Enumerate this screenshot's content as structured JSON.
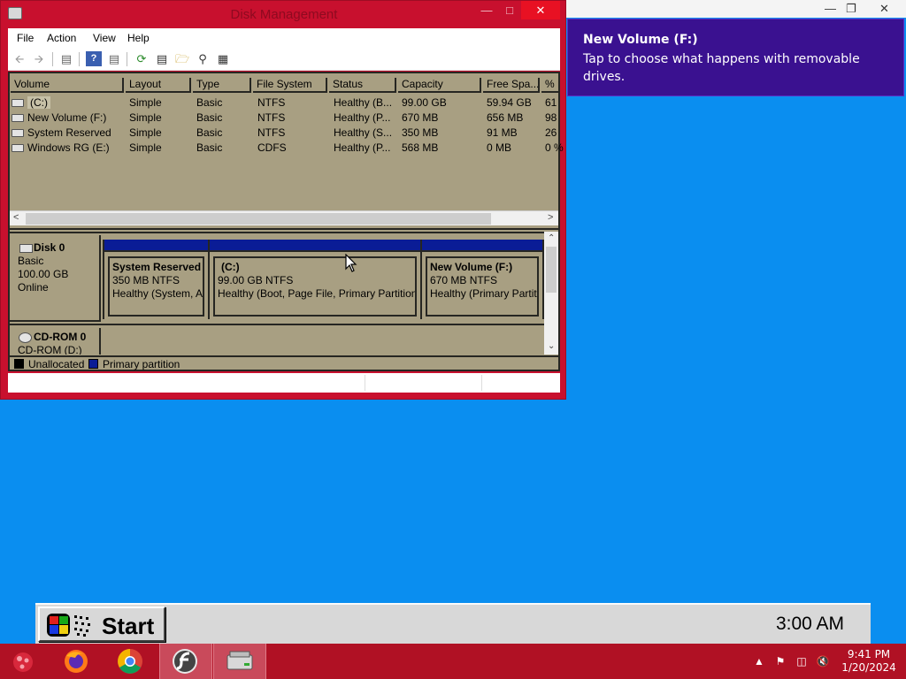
{
  "dm_window": {
    "title": "Disk Management",
    "menu": [
      "File",
      "Action",
      "View",
      "Help"
    ],
    "columns": [
      "Volume",
      "Layout",
      "Type",
      "File System",
      "Status",
      "Capacity",
      "Free Spa...",
      "% F"
    ],
    "volumes": [
      {
        "volume": "(C:)",
        "layout": "Simple",
        "type": "Basic",
        "fs": "NTFS",
        "status": "Healthy (B...",
        "capacity": "99.00 GB",
        "free": "59.94 GB",
        "pct": "61"
      },
      {
        "volume": "New Volume (F:)",
        "layout": "Simple",
        "type": "Basic",
        "fs": "NTFS",
        "status": "Healthy (P...",
        "capacity": "670 MB",
        "free": "656 MB",
        "pct": "98"
      },
      {
        "volume": "System Reserved",
        "layout": "Simple",
        "type": "Basic",
        "fs": "NTFS",
        "status": "Healthy (S...",
        "capacity": "350 MB",
        "free": "91 MB",
        "pct": "26"
      },
      {
        "volume": "Windows RG (E:)",
        "layout": "Simple",
        "type": "Basic",
        "fs": "CDFS",
        "status": "Healthy (P...",
        "capacity": "568 MB",
        "free": "0 MB",
        "pct": "0 %"
      }
    ],
    "disk0": {
      "name": "Disk 0",
      "type": "Basic",
      "size": "100.00 GB",
      "state": "Online"
    },
    "partitions": [
      {
        "name": "System Reserved",
        "size": "350 MB NTFS",
        "status": "Healthy (System, Ac"
      },
      {
        "name": "(C:)",
        "size": "99.00 GB NTFS",
        "status": "Healthy (Boot, Page File, Primary Partition)"
      },
      {
        "name": "New Volume  (F:)",
        "size": "670 MB NTFS",
        "status": "Healthy (Primary Partit"
      }
    ],
    "cdrom": {
      "name": "CD-ROM 0",
      "sub": "CD-ROM (D:)"
    },
    "legend": {
      "unallocated": "Unallocated",
      "primary": "Primary partition",
      "unallocated_color": "#000000",
      "primary_color": "#0a1c96"
    }
  },
  "notification": {
    "title": "New Volume (F:)",
    "body": "Tap to choose what happens with removable drives."
  },
  "retro_bar": {
    "start_label": "Start",
    "clock": "3:00 AM"
  },
  "taskbar": {
    "apps": [
      "start-orb",
      "firefox",
      "chrome",
      "flash",
      "disk-management"
    ],
    "time": "9:41 PM",
    "date": "1/20/2024"
  },
  "colors": {
    "desktop": "#0a8ef0",
    "window_frame": "#c8102e",
    "content_bg": "#a89f82",
    "notification_bg": "#3a1190",
    "taskbar": "#b01124"
  }
}
